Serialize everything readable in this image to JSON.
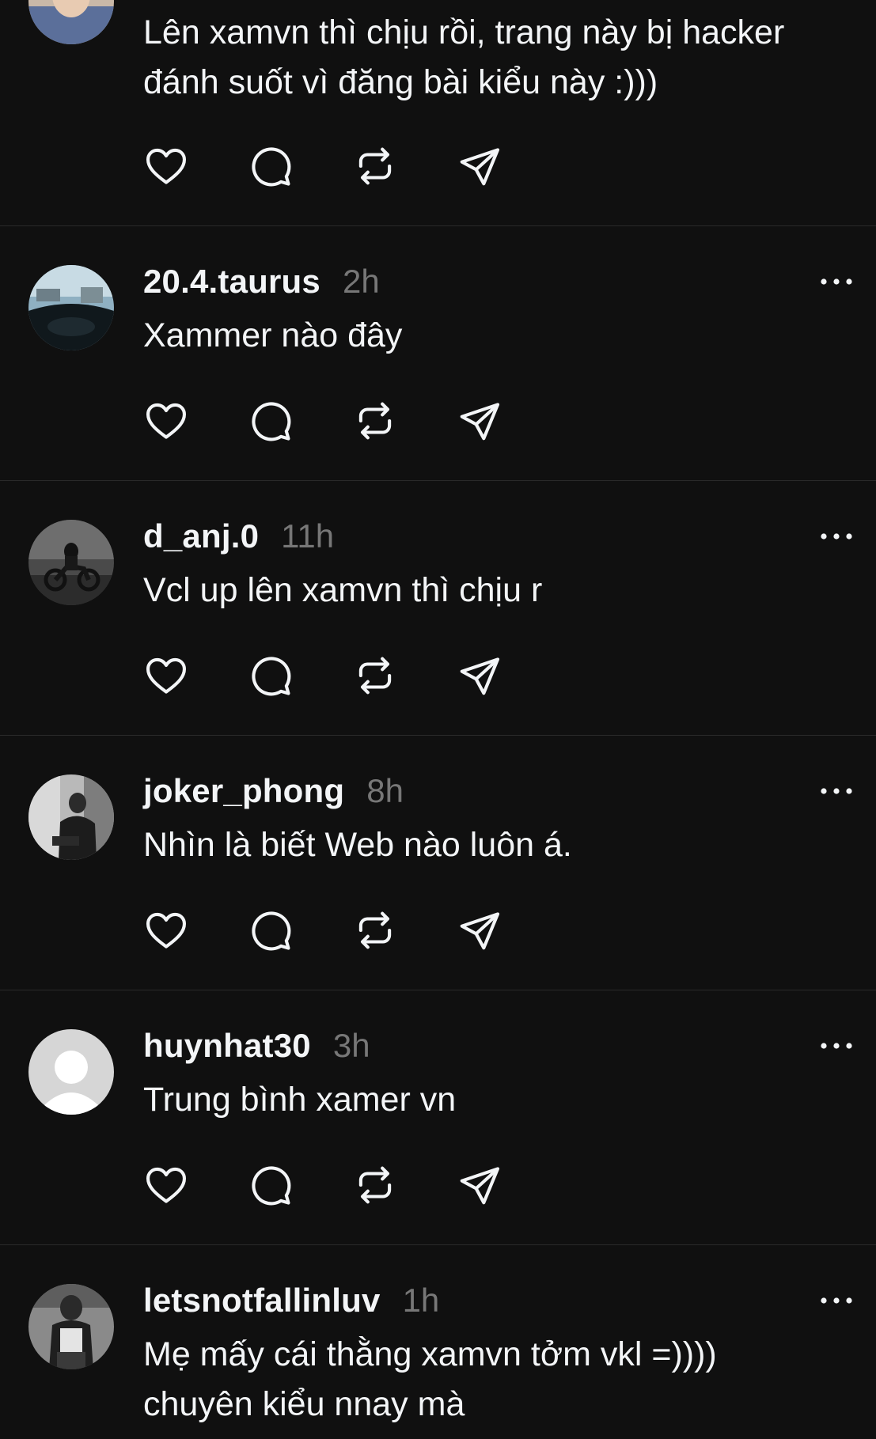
{
  "theme": {
    "background": "#101010",
    "text": "#f3f5f7",
    "muted": "#777777",
    "divider": "#2a2a2a"
  },
  "posts": [
    {
      "username": "",
      "time": "",
      "lines": [
        "Lên xamvn thì chịu rồi, trang này bị hacker",
        "đánh suốt vì đăng bài kiểu này :)))"
      ],
      "avatar": "photo-avatar-man"
    },
    {
      "username": "20.4.taurus",
      "time": "2h",
      "lines": [
        "Xammer nào đây"
      ],
      "avatar": "photo-avatar-car-dashboard"
    },
    {
      "username": "d_anj.0",
      "time": "11h",
      "lines": [
        "Vcl up lên xamvn thì chịu r"
      ],
      "avatar": "photo-avatar-motorbike"
    },
    {
      "username": "joker_phong",
      "time": "8h",
      "lines": [
        "Nhìn là biết Web nào luôn á."
      ],
      "avatar": "photo-avatar-person-sitting"
    },
    {
      "username": "huynhat30",
      "time": "3h",
      "lines": [
        "Trung bình xamer vn"
      ],
      "avatar": "default-avatar-icon"
    },
    {
      "username": "letsnotfallinluv",
      "time": "1h",
      "lines": [
        "Mẹ mấy cái thằng xamvn tởm vkl =))))",
        "chuyên kiểu nnay mà"
      ],
      "avatar": "photo-avatar-mirror-selfie"
    }
  ],
  "icons": {
    "like": "heart-icon",
    "reply": "comment-icon",
    "repost": "repost-icon",
    "share": "send-icon",
    "more": "more-options-icon"
  }
}
